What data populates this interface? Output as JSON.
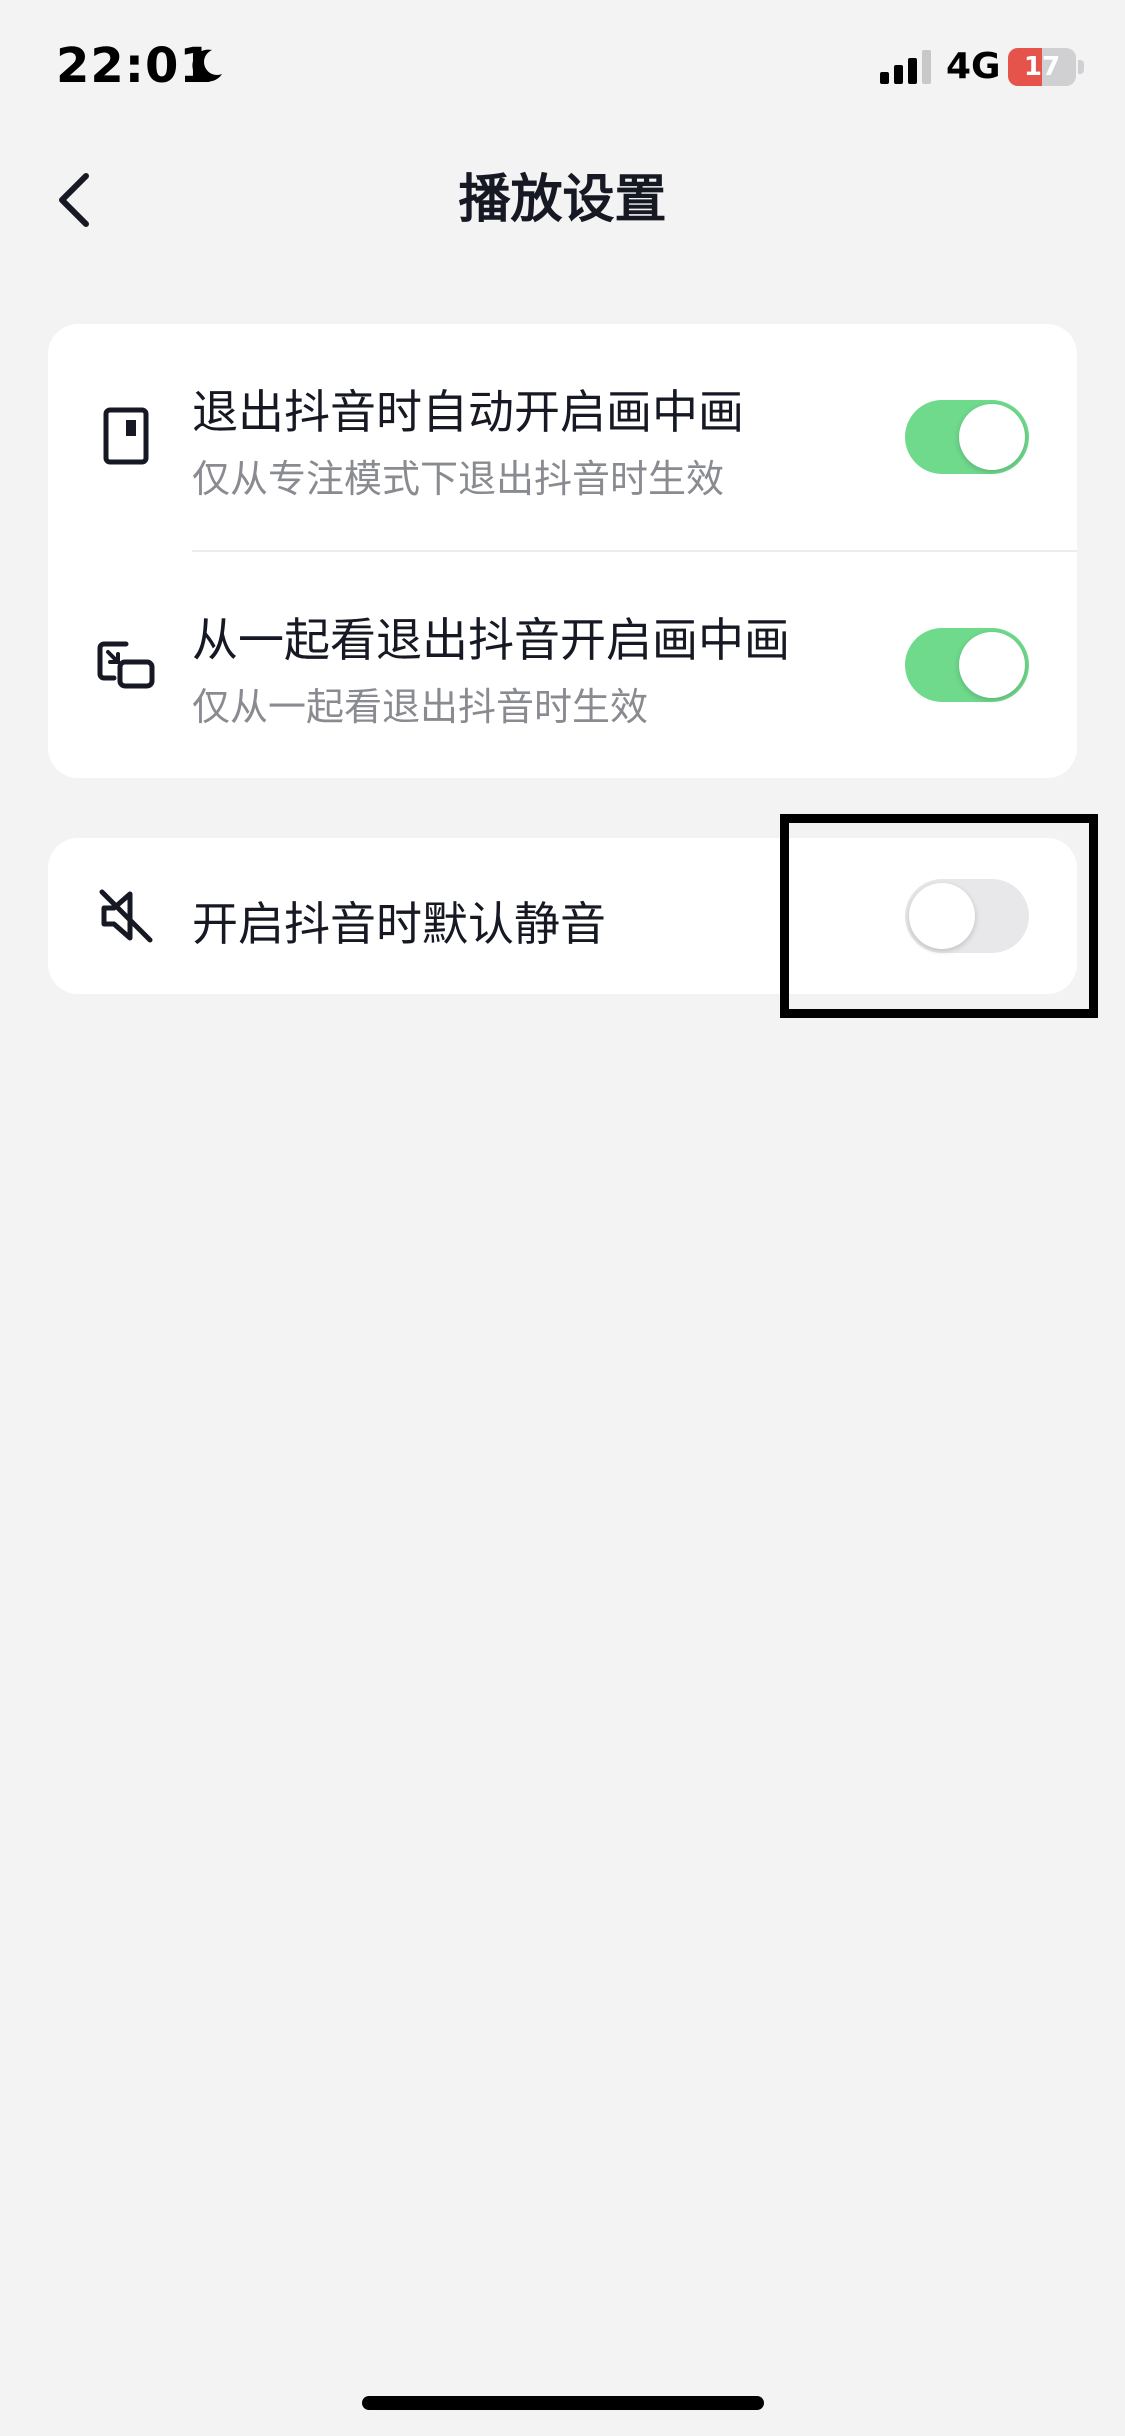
{
  "status_bar": {
    "time": "22:01",
    "network": "4G",
    "battery": "17",
    "battery_level_percent": 17,
    "icons": [
      "moon-icon",
      "signal-icon",
      "battery-icon"
    ]
  },
  "nav": {
    "title": "播放设置",
    "back_icon": "chevron-left-icon"
  },
  "settings": {
    "group1": [
      {
        "title": "退出抖音时自动开启画中画",
        "subtitle": "仅从专注模式下退出抖音时生效",
        "icon": "focus-mode-icon",
        "enabled": true
      },
      {
        "title": "从一起看退出抖音开启画中画",
        "subtitle": "仅从一起看退出抖音时生效",
        "icon": "pip-icon",
        "enabled": true
      }
    ],
    "group2": [
      {
        "title": "开启抖音时默认静音",
        "icon": "mute-icon",
        "enabled": false
      }
    ]
  },
  "colors": {
    "background": "#f3f3f3",
    "card": "#ffffff",
    "toggle_on": "#6fd98c",
    "toggle_off": "#e8e8ea",
    "battery_low": "#e5534b",
    "subtitle": "#8a8b91"
  }
}
